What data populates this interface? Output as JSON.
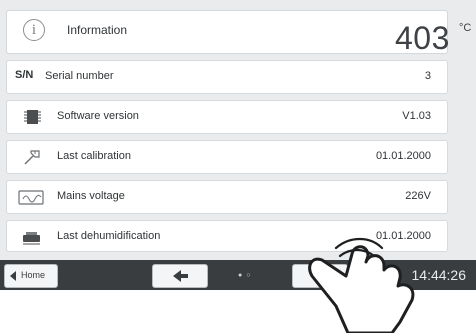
{
  "header": {
    "title": "Information",
    "temperature": "403",
    "temperature_unit": "°C",
    "icon": "info-icon"
  },
  "rows": [
    {
      "prefix": "S/N",
      "label": "Serial number",
      "value": "3",
      "icon": "serial-number-icon"
    },
    {
      "label": "Software version",
      "value": "V1.03",
      "icon": "chip-icon"
    },
    {
      "label": "Last calibration",
      "value": "01.01.2000",
      "icon": "calibration-icon"
    },
    {
      "label": "Mains voltage",
      "value": "226V",
      "icon": "mains-voltage-icon"
    },
    {
      "label": "Last dehumidification",
      "value": "01.01.2000",
      "icon": "dehumidification-icon"
    }
  ],
  "bottombar": {
    "home_label": "Home",
    "page_indicator": "●○",
    "time": "14:44:26"
  },
  "colors": {
    "screen_bg": "#e9ebec",
    "bar_bg": "#3a3d40",
    "text": "#2f3437"
  }
}
